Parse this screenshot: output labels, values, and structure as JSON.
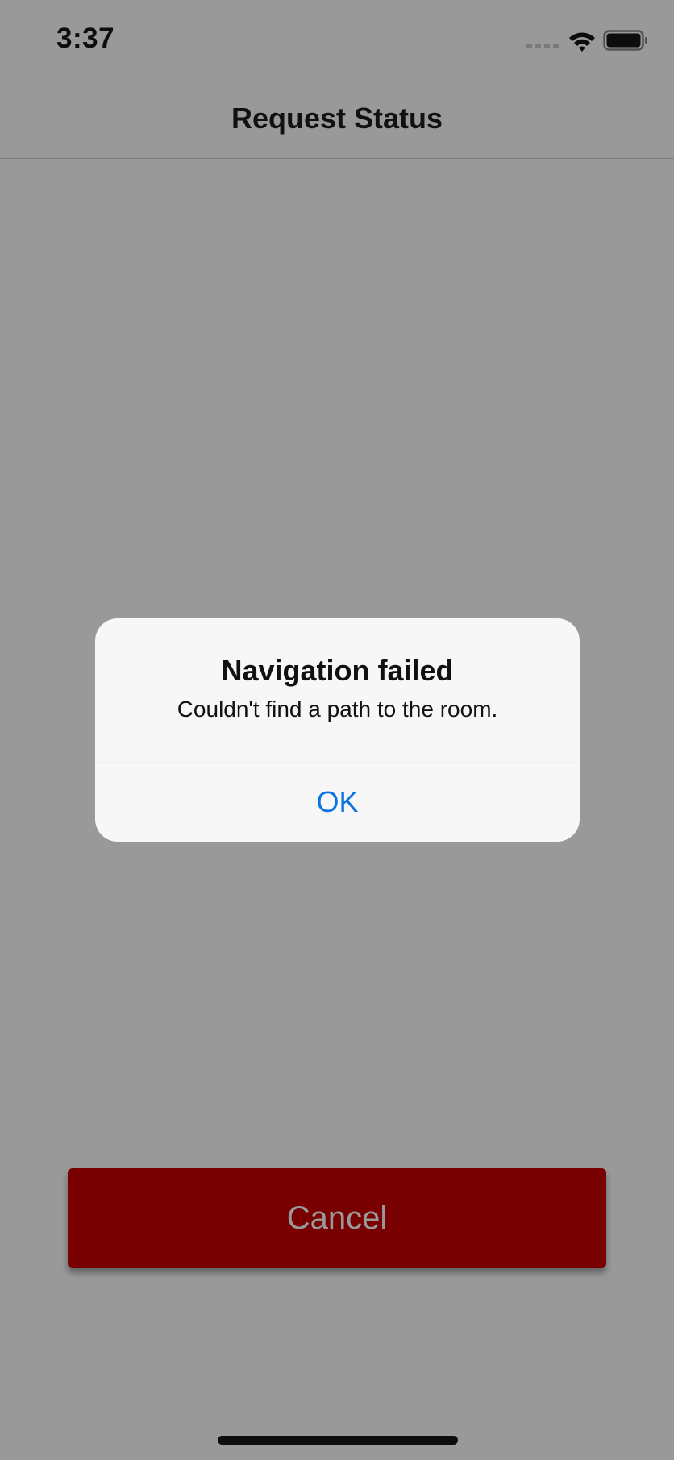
{
  "status_bar": {
    "time": "3:37",
    "icons": [
      "signal-icon",
      "wifi-icon",
      "battery-icon"
    ]
  },
  "nav": {
    "title": "Request Status"
  },
  "alert": {
    "title": "Navigation failed",
    "message": "Couldn't find a path to the room.",
    "ok_label": "OK",
    "ok_color": "#0a74e0"
  },
  "actions": {
    "cancel_label": "Cancel",
    "cancel_color": "#780000"
  },
  "colors": {
    "background": "#999999",
    "alert_background": "#f7f7f7"
  }
}
